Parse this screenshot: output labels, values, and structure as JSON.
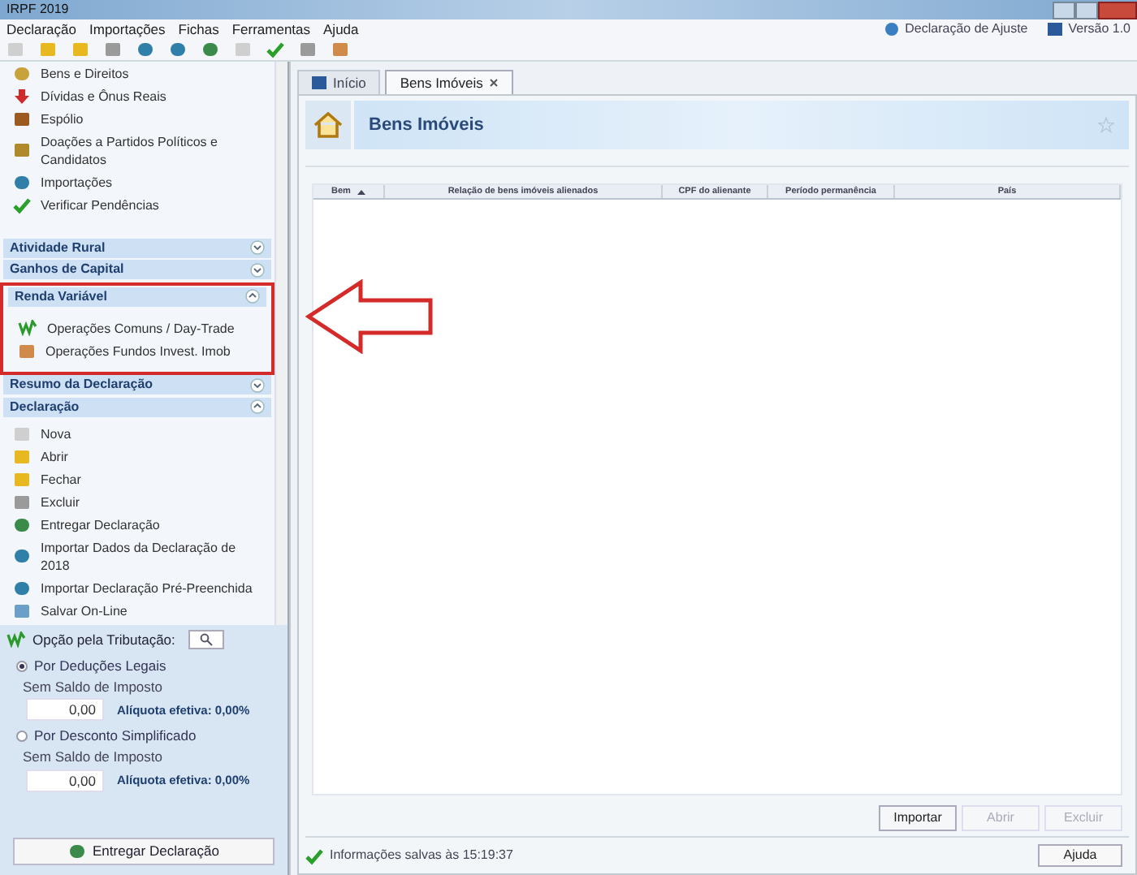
{
  "window": {
    "title": "IRPF 2019"
  },
  "menu": [
    "Declaração",
    "Importações",
    "Fichas",
    "Ferramentas",
    "Ajuda"
  ],
  "header_info": [
    {
      "kind": "mode",
      "label": "Declaração de Ajuste"
    },
    {
      "kind": "version",
      "label": "Versão 1.0"
    }
  ],
  "sidebar": {
    "top_items": [
      {
        "label": "Bens e Direitos"
      },
      {
        "label": "Dívidas e Ônus Reais"
      },
      {
        "label": "Espólio"
      },
      {
        "label": "Doações a Partidos Políticos e Candidatos"
      },
      {
        "label": "Importações"
      },
      {
        "label": "Verificar Pendências"
      }
    ],
    "sections": [
      {
        "title": "Atividade Rural",
        "expanded": false
      },
      {
        "title": "Ganhos de Capital",
        "expanded": false
      },
      {
        "title": "Renda Variável",
        "expanded": true,
        "items": [
          {
            "label": "Operações Comuns / Day-Trade"
          },
          {
            "label": "Operações Fundos Invest. Imob"
          }
        ]
      },
      {
        "title": "Resumo da Declaração",
        "expanded": false
      },
      {
        "title": "Declaração",
        "expanded": true,
        "items": [
          {
            "label": "Nova"
          },
          {
            "label": "Abrir"
          },
          {
            "label": "Fechar"
          },
          {
            "label": "Excluir"
          },
          {
            "label": "Entregar Declaração"
          },
          {
            "label": "Importar Dados da Declaração de 2018"
          },
          {
            "label": "Importar Declaração Pré-Preenchida"
          },
          {
            "label": "Salvar On-Line"
          }
        ]
      }
    ]
  },
  "taxation": {
    "title": "Opção pela Tributação:",
    "options": [
      {
        "label": "Por Deduções Legais",
        "selected": true,
        "balance_label": "Sem Saldo de Imposto",
        "value": "0,00",
        "rate": "Alíquota efetiva: 0,00%"
      },
      {
        "label": "Por Desconto Simplificado",
        "selected": false,
        "balance_label": "Sem Saldo de Imposto",
        "value": "0,00",
        "rate": "Alíquota efetiva: 0,00%"
      }
    ],
    "submit": "Entregar Declaração"
  },
  "tabs": [
    {
      "label": "Início",
      "selected": false,
      "closable": false
    },
    {
      "label": "Bens Imóveis",
      "selected": true,
      "closable": true
    }
  ],
  "page_title": "Bens Imóveis",
  "table": {
    "columns": [
      {
        "label": "Bem",
        "sorted": true
      },
      {
        "label": "Relação de bens imóveis alienados",
        "sorted": false
      },
      {
        "label": "CPF do alienante",
        "sorted": false
      },
      {
        "label": "Período permanência",
        "sorted": false
      },
      {
        "label": "País",
        "sorted": false
      }
    ]
  },
  "buttons": [
    {
      "label": "Importar",
      "disabled": false
    },
    {
      "label": "Abrir",
      "disabled": true
    },
    {
      "label": "Excluir",
      "disabled": true
    }
  ],
  "status_bar": {
    "text": "Informações salvas às 15:19:37",
    "help": "Ajuda"
  }
}
